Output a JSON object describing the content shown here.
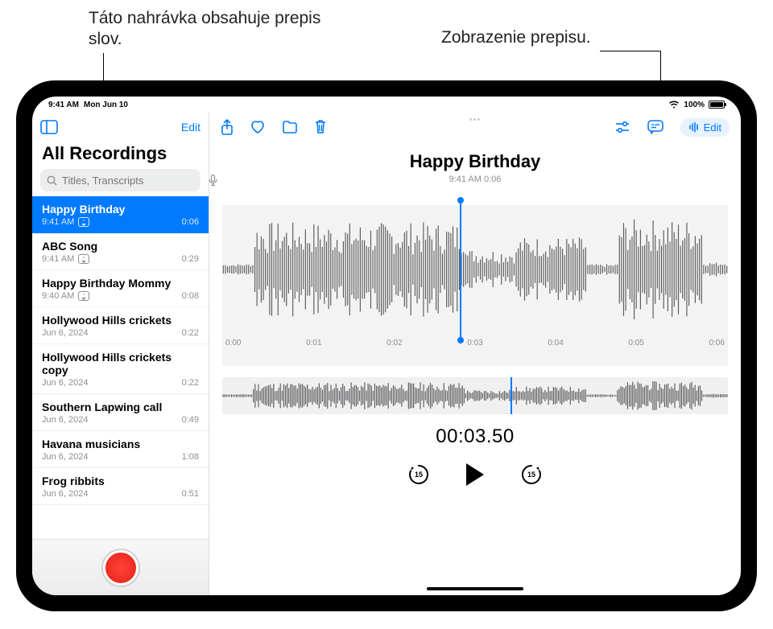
{
  "callouts": {
    "left": "Táto nahrávka obsahuje prepis slov.",
    "right": "Zobrazenie prepisu."
  },
  "statusbar": {
    "time": "9:41 AM",
    "date": "Mon Jun 10",
    "battery": "100%"
  },
  "sidebar": {
    "edit": "Edit",
    "title": "All Recordings",
    "search_placeholder": "Titles, Transcripts"
  },
  "recordings": [
    {
      "title": "Happy Birthday",
      "time": "9:41 AM",
      "duration": "0:06",
      "transcript": true,
      "selected": true
    },
    {
      "title": "ABC Song",
      "time": "9:41 AM",
      "duration": "0:29",
      "transcript": true,
      "selected": false
    },
    {
      "title": "Happy Birthday Mommy",
      "time": "9:40 AM",
      "duration": "0:08",
      "transcript": true,
      "selected": false
    },
    {
      "title": "Hollywood Hills crickets",
      "time": "Jun 6, 2024",
      "duration": "0:22",
      "transcript": false,
      "selected": false
    },
    {
      "title": "Hollywood Hills crickets copy",
      "time": "Jun 6, 2024",
      "duration": "0:22",
      "transcript": false,
      "selected": false
    },
    {
      "title": "Southern Lapwing call",
      "time": "Jun 6, 2024",
      "duration": "0:49",
      "transcript": false,
      "selected": false
    },
    {
      "title": "Havana musicians",
      "time": "Jun 6, 2024",
      "duration": "1:08",
      "transcript": false,
      "selected": false
    },
    {
      "title": "Frog ribbits",
      "time": "Jun 6, 2024",
      "duration": "0:51",
      "transcript": false,
      "selected": false
    }
  ],
  "detail": {
    "title": "Happy Birthday",
    "subtitle": "9:41 AM   0:06",
    "timecode": "00:03.50",
    "edit_label": "Edit",
    "skip_amount": "15",
    "ruler": [
      "0:00",
      "0:01",
      "0:02",
      "0:03",
      "0:04",
      "0:05",
      "0:06"
    ]
  }
}
